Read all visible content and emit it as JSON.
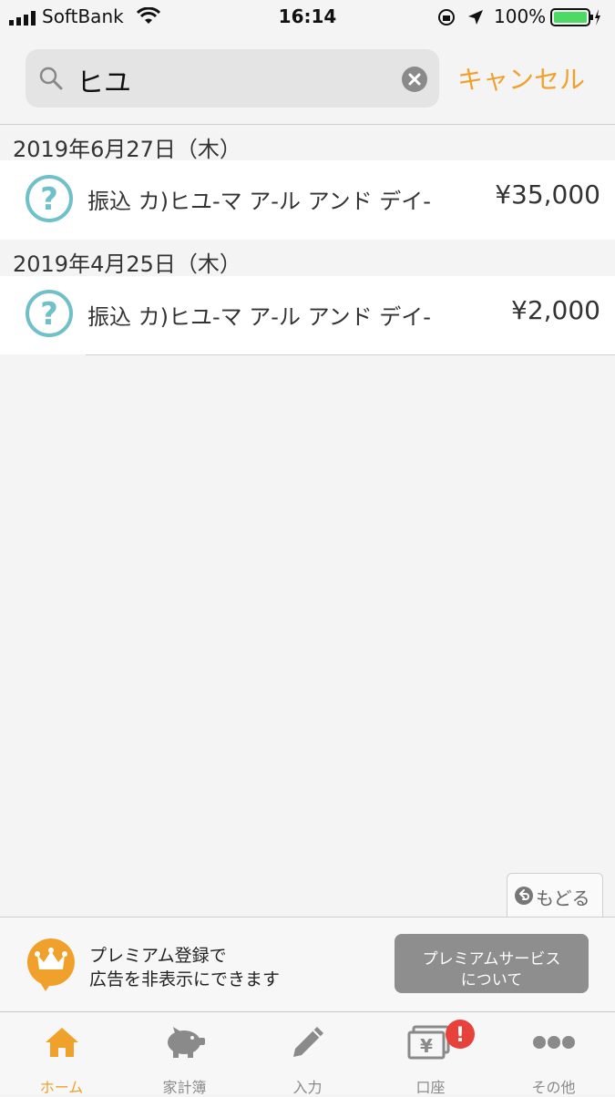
{
  "status_bar": {
    "carrier": "SoftBank",
    "time": "16:14",
    "battery": "100%"
  },
  "search": {
    "query": "ヒユ",
    "cancel_label": "キャンセル"
  },
  "groups": [
    {
      "date": "2019年6月27日（木）",
      "items": [
        {
          "title": "振込 カ)ヒユ-マ ア-ル アンド デイ-",
          "amount": "¥35,000"
        }
      ]
    },
    {
      "date": "2019年4月25日（木）",
      "items": [
        {
          "title": "振込 カ)ヒユ-マ ア-ル アンド デイ-",
          "amount": "¥2,000"
        }
      ]
    }
  ],
  "back_button": {
    "label": "もどる"
  },
  "ad": {
    "line1": "プレミアム登録で",
    "line2": "広告を非表示にできます",
    "button_line1": "プレミアムサービス",
    "button_line2": "について"
  },
  "tabs": [
    {
      "label": "ホーム",
      "icon": "home-icon",
      "active": true
    },
    {
      "label": "家計簿",
      "icon": "piggy-bank-icon",
      "active": false
    },
    {
      "label": "入力",
      "icon": "pencil-icon",
      "active": false
    },
    {
      "label": "口座",
      "icon": "yen-account-icon",
      "active": false
    },
    {
      "label": "その他",
      "icon": "more-icon",
      "active": false
    }
  ],
  "colors": {
    "accent": "#f0a12c",
    "question_icon": "#6fc0c9",
    "badge": "#e8413b",
    "tab_inactive": "#8a8a8a"
  }
}
